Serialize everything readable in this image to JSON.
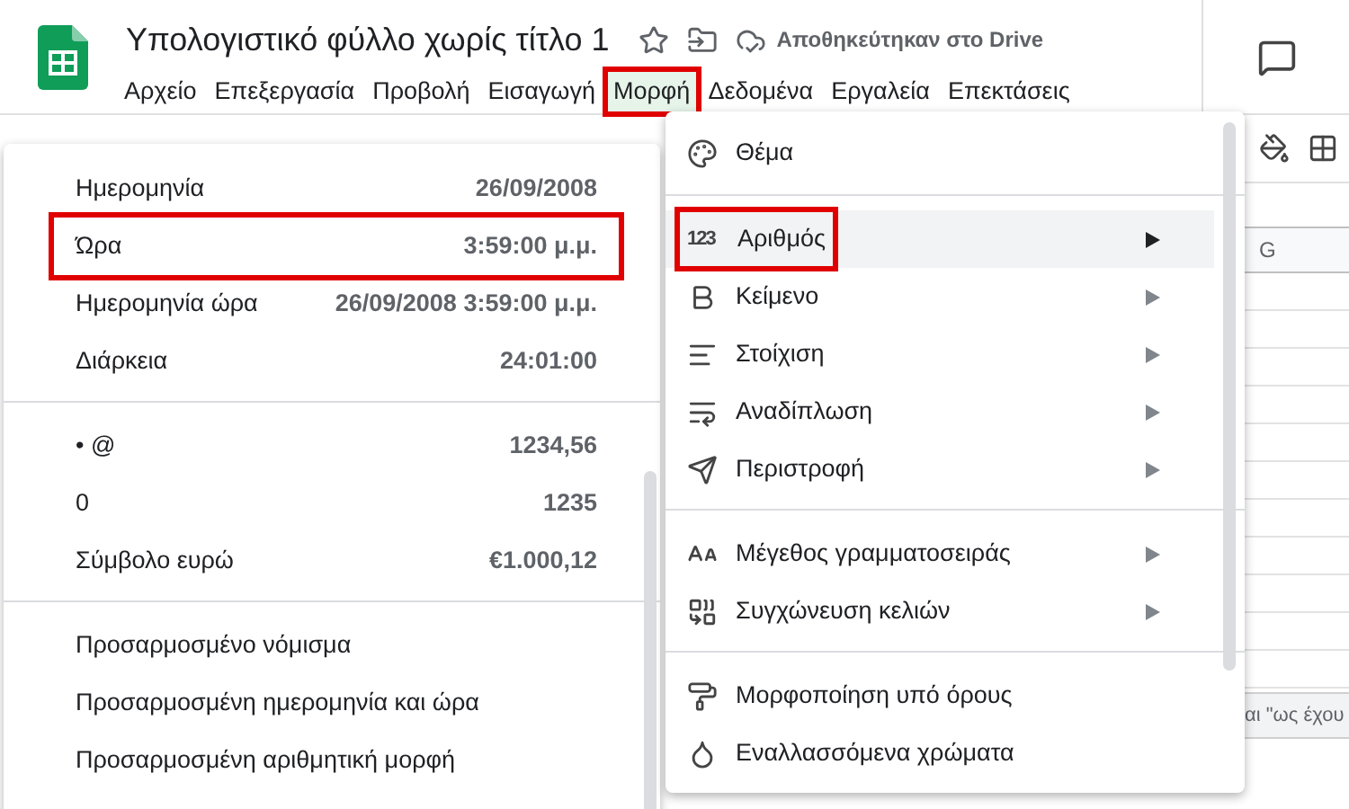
{
  "document": {
    "title": "Υπολογιστικό φύλλο χωρίς τίτλο 1",
    "save_status": "Αποθηκεύτηκαν στο Drive"
  },
  "menu_bar": [
    {
      "label": "Αρχείο",
      "selected": false,
      "highlighted": false
    },
    {
      "label": "Επεξεργασία",
      "selected": false,
      "highlighted": false
    },
    {
      "label": "Προβολή",
      "selected": false,
      "highlighted": false
    },
    {
      "label": "Εισαγωγή",
      "selected": false,
      "highlighted": false
    },
    {
      "label": "Μορφή",
      "selected": true,
      "highlighted": true
    },
    {
      "label": "Δεδομένα",
      "selected": false,
      "highlighted": false
    },
    {
      "label": "Εργαλεία",
      "selected": false,
      "highlighted": false
    },
    {
      "label": "Επεκτάσεις",
      "selected": false,
      "highlighted": false
    }
  ],
  "sheet": {
    "column_header": "G",
    "cell_text": "αι \"ως έχου"
  },
  "format_menu": [
    [
      {
        "label": "Θέμα",
        "has_submenu": false,
        "selected": false,
        "highlighted": false
      }
    ],
    [
      {
        "label": "Αριθμός",
        "icon_text": "123",
        "has_submenu": true,
        "selected": true,
        "highlighted": true
      },
      {
        "label": "Κείμενο",
        "has_submenu": true,
        "selected": false,
        "highlighted": false
      },
      {
        "label": "Στοίχιση",
        "has_submenu": true,
        "selected": false,
        "highlighted": false
      },
      {
        "label": "Αναδίπλωση",
        "has_submenu": true,
        "selected": false,
        "highlighted": false
      },
      {
        "label": "Περιστροφή",
        "has_submenu": true,
        "selected": false,
        "highlighted": false
      }
    ],
    [
      {
        "label": "Μέγεθος γραμματοσειράς",
        "has_submenu": true,
        "selected": false,
        "highlighted": false
      },
      {
        "label": "Συγχώνευση κελιών",
        "has_submenu": true,
        "selected": false,
        "highlighted": false
      }
    ],
    [
      {
        "label": "Μορφοποίηση υπό όρους",
        "has_submenu": false,
        "selected": false,
        "highlighted": false
      },
      {
        "label": "Εναλλασσόμενα χρώματα",
        "has_submenu": false,
        "selected": false,
        "highlighted": false
      }
    ]
  ],
  "number_submenu": [
    [
      {
        "label": "Ημερομηνία",
        "example": "26/09/2008",
        "highlighted": false
      },
      {
        "label": "Ώρα",
        "example": "3:59:00 μ.μ.",
        "highlighted": true
      },
      {
        "label": "Ημερομηνία ώρα",
        "example": "26/09/2008 3:59:00 μ.μ.",
        "highlighted": false
      },
      {
        "label": "Διάρκεια",
        "example": "24:01:00",
        "highlighted": false
      }
    ],
    [
      {
        "label": "• @",
        "example": "1234,56",
        "highlighted": false
      },
      {
        "label": "0",
        "example": "1235",
        "highlighted": false
      },
      {
        "label": "Σύμβολο ευρώ",
        "example": "€1.000,12",
        "highlighted": false
      }
    ],
    [
      {
        "label": "Προσαρμοσμένο νόμισμα",
        "highlighted": false
      },
      {
        "label": "Προσαρμοσμένη ημερομηνία και ώρα",
        "highlighted": false
      },
      {
        "label": "Προσαρμοσμένη αριθμητική μορφή",
        "highlighted": false
      }
    ]
  ]
}
